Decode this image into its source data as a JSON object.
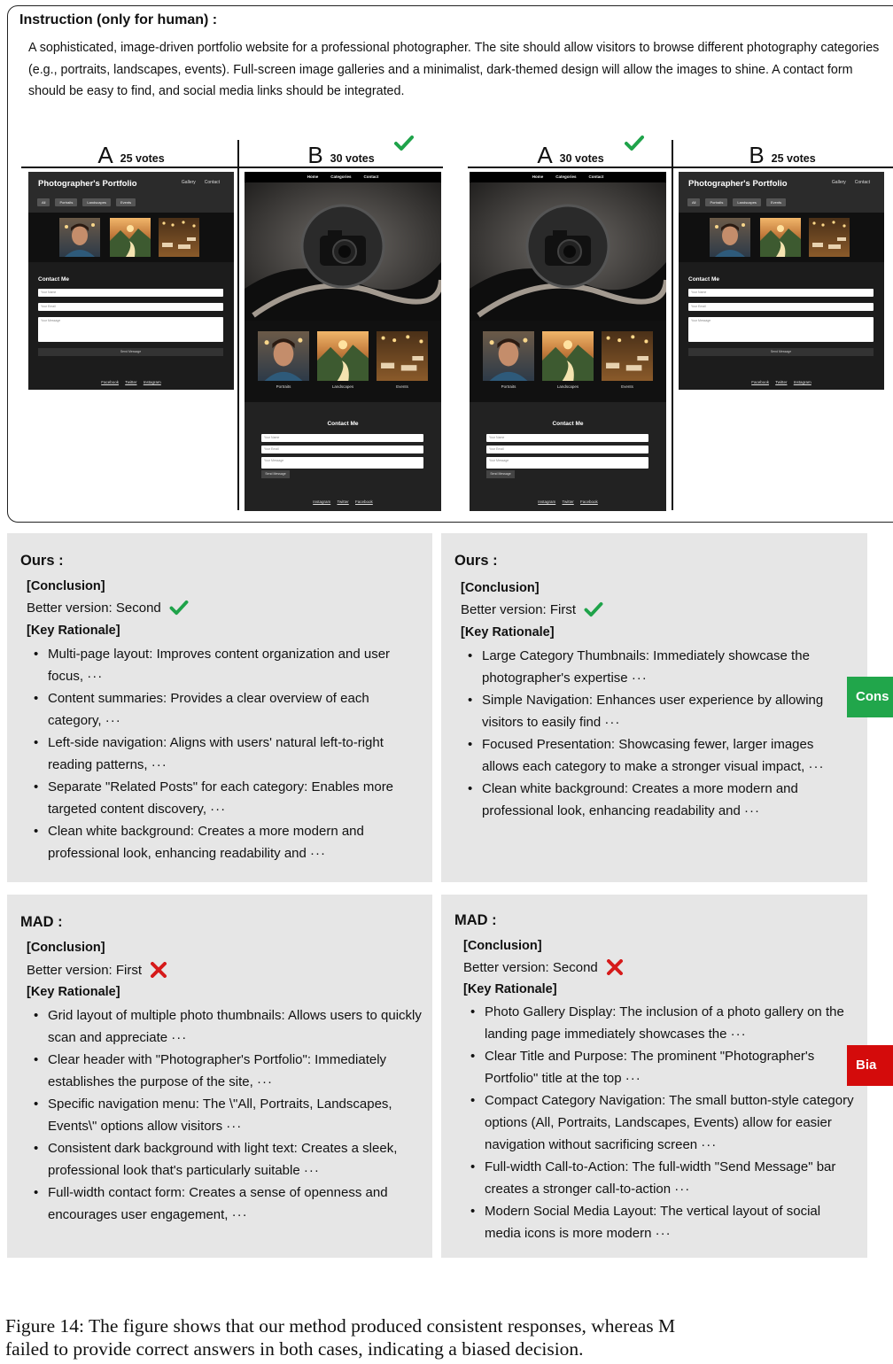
{
  "instruction": {
    "title": "Instruction (only for human) :",
    "text": "A sophisticated, image-driven portfolio website for a professional photographer. The site should allow visitors to browse different photography categories (e.g., portraits, landscapes, events). Full-screen image galleries and a minimalist, dark-themed design will allow the images to shine. A contact form should be easy to find, and social media links should be integrated."
  },
  "votes": {
    "case1": {
      "left": {
        "letter": "A",
        "count": "25 votes",
        "winner": false
      },
      "right": {
        "letter": "B",
        "count": "30 votes",
        "winner": true
      }
    },
    "case2": {
      "left": {
        "letter": "A",
        "count": "30 votes",
        "winner": true
      },
      "right": {
        "letter": "B",
        "count": "25 votes",
        "winner": false
      }
    }
  },
  "mock_short": {
    "title": "Photographer's Portfolio",
    "nav": [
      "Gallery",
      "Contact"
    ],
    "filters": [
      "All",
      "Portraits",
      "Landscapes",
      "Events"
    ],
    "contact_title": "Contact Me",
    "fields": [
      "Your Name",
      "Your Email",
      "Your Message"
    ],
    "send": "Send Message",
    "social": [
      "Facebook",
      "Twitter",
      "Instagram"
    ]
  },
  "mock_tall": {
    "nav": [
      "Home",
      "Categories",
      "Contact"
    ],
    "captions": [
      "Portraits",
      "Landscapes",
      "Events"
    ],
    "contact_title": "Contact Me",
    "fields": [
      "Your Name",
      "Your Email",
      "Your Message"
    ],
    "send": "Send Message",
    "social": [
      "Instagram",
      "Twitter",
      "Facebook"
    ]
  },
  "ours_case1": {
    "heading": "Ours :",
    "conclusion_label": "[Conclusion]",
    "verdict": "Better version: Second",
    "correct": true,
    "rationale_label": "[Key Rationale]",
    "points": [
      "Multi-page layout: Improves content organization and user focus,",
      "Content summaries: Provides a clear overview of each category,",
      "Left-side navigation: Aligns with users' natural left-to-right reading patterns,",
      "Separate \"Related Posts\" for each category: Enables more targeted content discovery,",
      "Clean white background: Creates a more modern and professional look, enhancing readability and"
    ]
  },
  "ours_case2": {
    "heading": "Ours :",
    "conclusion_label": "[Conclusion]",
    "verdict": "Better version: First",
    "correct": true,
    "rationale_label": "[Key Rationale]",
    "points": [
      "Large Category Thumbnails: Immediately showcase the photographer's expertise",
      "Simple Navigation: Enhances user experience by allowing visitors to easily find",
      "Focused Presentation: Showcasing fewer, larger images allows each category to make a stronger visual impact,",
      "Clean white background: Creates a more modern and professional look, enhancing readability and"
    ]
  },
  "mad_case1": {
    "heading": "MAD :",
    "conclusion_label": "[Conclusion]",
    "verdict": "Better version: First",
    "correct": false,
    "rationale_label": "[Key Rationale]",
    "points": [
      "Grid layout of multiple photo thumbnails: Allows users to quickly scan and appreciate",
      "Clear header with \"Photographer's Portfolio\": Immediately establishes the purpose of the site,",
      "Specific navigation menu: The \\\"All, Portraits, Landscapes, Events\\\" options allow visitors",
      "Consistent dark background with light text: Creates a sleek, professional look that's particularly suitable",
      "Full-width contact form: Creates a sense of openness and encourages user engagement,"
    ]
  },
  "mad_case2": {
    "heading": "MAD :",
    "conclusion_label": "[Conclusion]",
    "verdict": "Better version: Second",
    "correct": false,
    "rationale_label": "[Key Rationale]",
    "points": [
      "Photo Gallery Display: The inclusion of a photo gallery on the landing page immediately showcases the",
      "Clear Title and Purpose: The prominent \"Photographer's Portfolio\" title at the top",
      "Compact Category Navigation: The small button-style category options (All, Portraits, Landscapes, Events) allow for easier navigation without sacrificing screen",
      "Full-width Call-to-Action: The full-width \"Send Message\" bar creates a stronger call-to-action",
      "Modern Social Media Layout: The vertical layout of social media icons is more modern"
    ]
  },
  "ellipsis": "···",
  "tags": {
    "consistent": {
      "label": "Cons",
      "color": "#21a64b"
    },
    "biased": {
      "label": "Bia",
      "color": "#d40b0b"
    }
  },
  "colors": {
    "check": "#1fa34a",
    "cross": "#d61a1a",
    "box_bg": "#e6e6e6"
  },
  "caption": {
    "line1": "Figure 14: The figure shows that our method produced consistent responses, whereas M",
    "line2": "failed to provide correct answers in both cases, indicating a biased decision."
  }
}
